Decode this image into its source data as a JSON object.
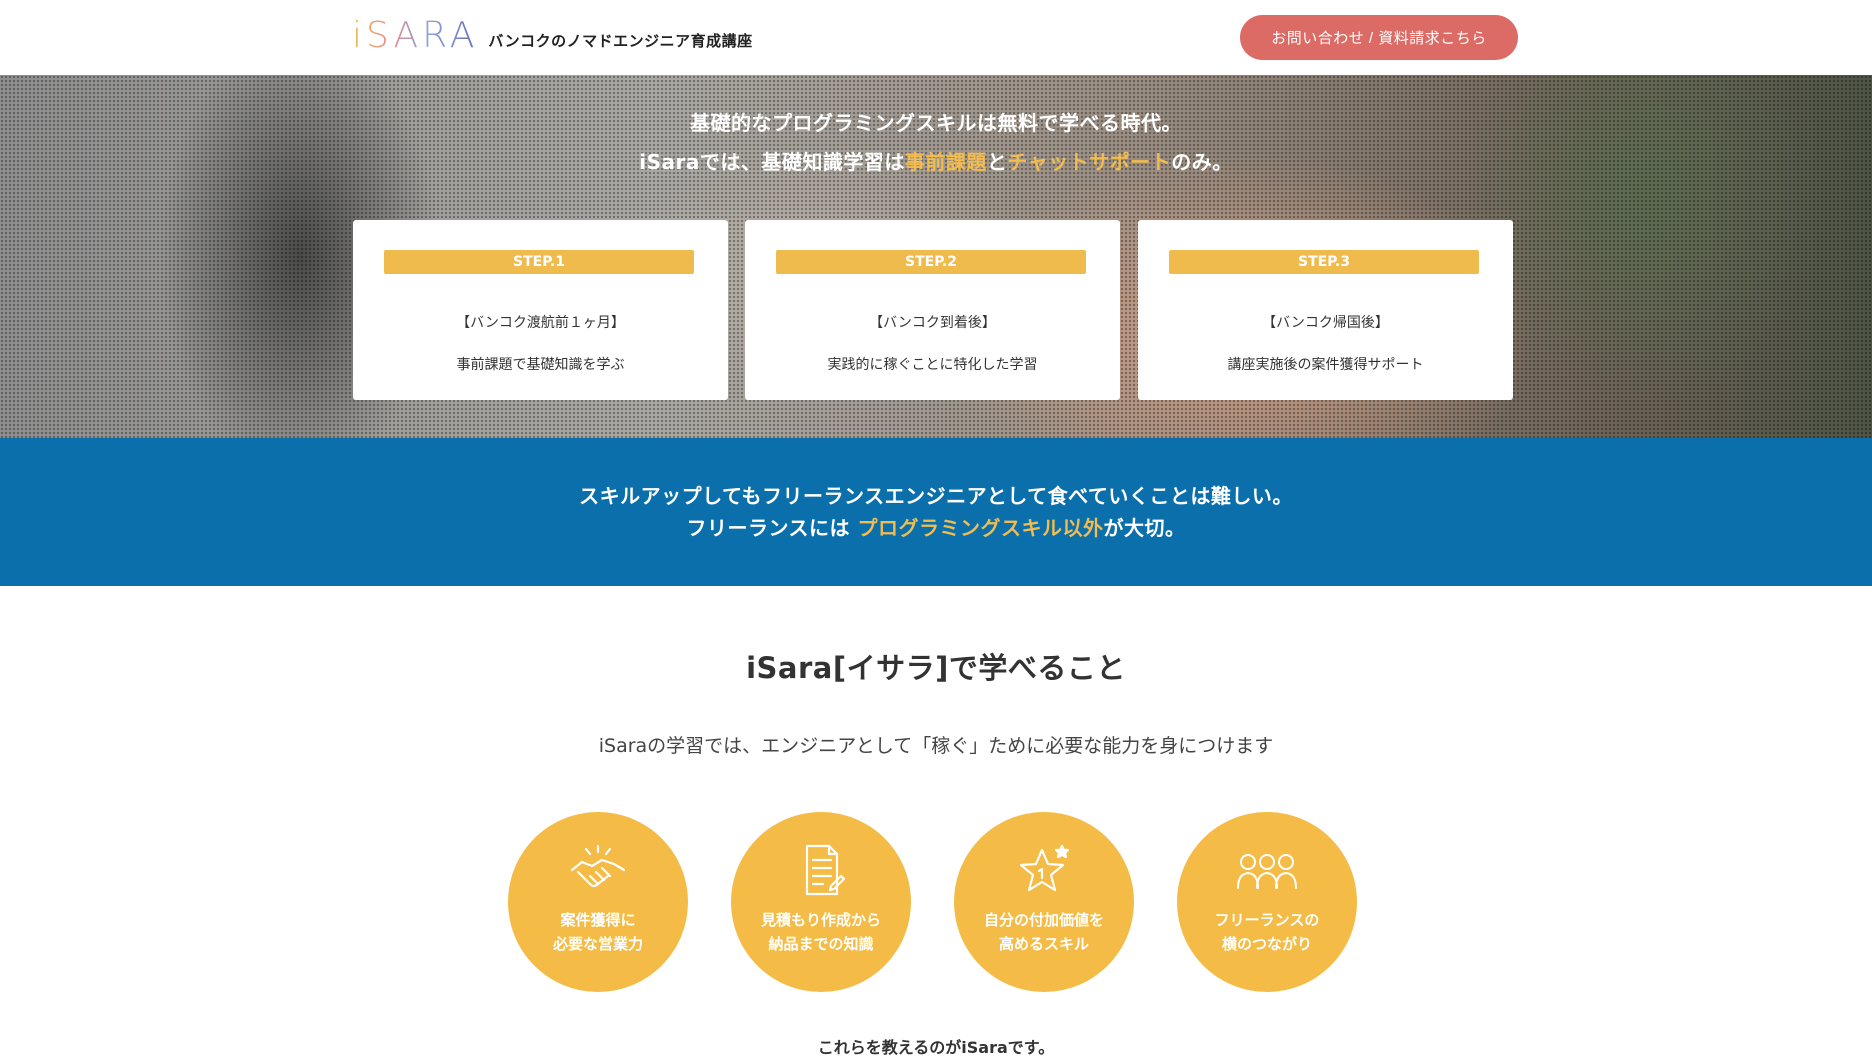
{
  "header": {
    "logo_text": "iSARA",
    "logo_subtitle": "バンコクのノマドエンジニア育成講座",
    "contact_button": "お問い合わせ / 資料請求こちら"
  },
  "hero": {
    "line1": "基礎的なプログラミングスキルは無料で学べる時代。",
    "line2_prefix": "iSaraでは、基礎知識学習は",
    "line2_hl1": "事前課題",
    "line2_mid": "と",
    "line2_hl2": "チャットサポート",
    "line2_suffix": "のみ。",
    "steps": [
      {
        "badge": "STEP.1",
        "title": "【バンコク渡航前１ヶ月】",
        "desc": "事前課題で基礎知識を学ぶ"
      },
      {
        "badge": "STEP.2",
        "title": "【バンコク到着後】",
        "desc": "実践的に稼ぐことに特化した学習"
      },
      {
        "badge": "STEP.3",
        "title": "【バンコク帰国後】",
        "desc": "講座実施後の案件獲得サポート"
      }
    ]
  },
  "band": {
    "line1": "スキルアップしてもフリーランスエンジニアとして食べていくことは難しい。",
    "line2_prefix": "フリーランスには ",
    "line2_hl": "プログラミングスキル以外",
    "line2_suffix": "が大切。"
  },
  "learn": {
    "title": "iSara[イサラ]で学べること",
    "subtitle": "iSaraの学習では、エンジニアとして「稼ぐ」ために必要な能力を身につけます",
    "items": [
      {
        "icon": "handshake-icon",
        "line1": "案件獲得に",
        "line2": "必要な営業力"
      },
      {
        "icon": "document-icon",
        "line1": "見積もり作成から",
        "line2": "納品までの知識"
      },
      {
        "icon": "star-icon",
        "line1": "自分の付加価値を",
        "line2": "高めるスキル"
      },
      {
        "icon": "people-icon",
        "line1": "フリーランスの",
        "line2": "横のつながり"
      }
    ],
    "closing": "これらを教えるのがiSaraです。"
  },
  "colors": {
    "accent_yellow": "#f4bc46",
    "contact_red": "#dc6b66",
    "band_blue": "#0b6fab"
  }
}
